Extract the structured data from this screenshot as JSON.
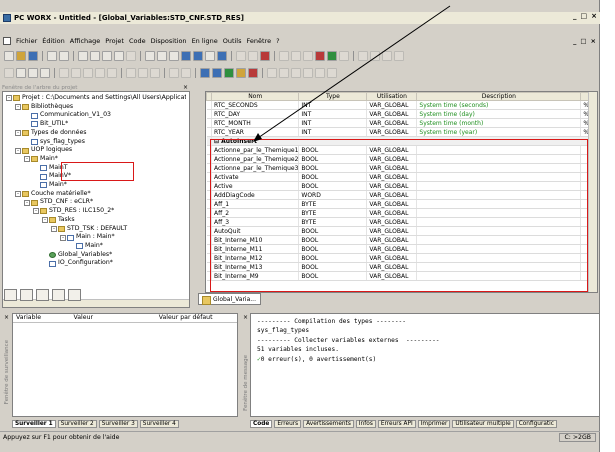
{
  "window": {
    "title": "PC WORX - Untitled - [Global_Variables:STD_CNF.STD_RES]",
    "minimize": "_",
    "restore": "□",
    "close": "×"
  },
  "menu": {
    "items": [
      "Fichier",
      "Édition",
      "Affichage",
      "Projet",
      "Code",
      "Disposition",
      "En ligne",
      "Outils",
      "Fenêtre",
      "?"
    ],
    "mdi_min": "_",
    "mdi_restore": "□",
    "mdi_close": "×"
  },
  "project_tree": {
    "caption": "Fenêtre de l'arbre du projet",
    "items": [
      {
        "text": "Projet : C:\\Documents and Settings\\All Users\\Applicat",
        "indent": 0,
        "icon": "folder",
        "pm": "-"
      },
      {
        "text": "Bibliothèques",
        "indent": 1,
        "icon": "folder",
        "pm": "-"
      },
      {
        "text": "Communication_V1_03",
        "indent": 2,
        "icon": "file",
        "pm": ""
      },
      {
        "text": "Bit_UTIL*",
        "indent": 2,
        "icon": "file",
        "pm": ""
      },
      {
        "text": "Types de données",
        "indent": 1,
        "icon": "folder",
        "pm": "-"
      },
      {
        "text": "sys_flag_types",
        "indent": 2,
        "icon": "file",
        "pm": ""
      },
      {
        "text": "UOP logiques",
        "indent": 1,
        "icon": "folder",
        "pm": "-"
      },
      {
        "text": "Main*",
        "indent": 2,
        "icon": "folder",
        "pm": "-"
      },
      {
        "text": "MainT",
        "indent": 3,
        "icon": "file",
        "pm": ""
      },
      {
        "text": "MainV*",
        "indent": 3,
        "icon": "file",
        "pm": ""
      },
      {
        "text": "Main*",
        "indent": 3,
        "icon": "file",
        "pm": ""
      },
      {
        "text": "Couche matérielle*",
        "indent": 1,
        "icon": "folder",
        "pm": "-"
      },
      {
        "text": "STD_CNF : eCLR*",
        "indent": 2,
        "icon": "folder",
        "pm": "-"
      },
      {
        "text": "STD_RES : ILC150_2*",
        "indent": 3,
        "icon": "folder",
        "pm": "-"
      },
      {
        "text": "Tasks",
        "indent": 4,
        "icon": "folder",
        "pm": "-"
      },
      {
        "text": "STD_TSK : DEFAULT",
        "indent": 5,
        "icon": "folder",
        "pm": "-"
      },
      {
        "text": "Main : Main*",
        "indent": 6,
        "icon": "file",
        "pm": "-"
      },
      {
        "text": "Main*",
        "indent": 7,
        "icon": "file",
        "pm": ""
      },
      {
        "text": "Global_Variables*",
        "indent": 4,
        "icon": "var",
        "pm": ""
      },
      {
        "text": "IO_Configuration*",
        "indent": 4,
        "icon": "file",
        "pm": ""
      }
    ]
  },
  "grid": {
    "headers": [
      "",
      "Nom",
      "Type",
      "Utilisation",
      "Description",
      ""
    ],
    "rows": [
      {
        "name": "RTC_SECONDS",
        "type": "INT",
        "usage": "VAR_GLOBAL",
        "desc": "System time (seconds)",
        "extra": "%"
      },
      {
        "name": "RTC_DAY",
        "type": "INT",
        "usage": "VAR_GLOBAL",
        "desc": "System time (day)",
        "extra": "%"
      },
      {
        "name": "RTC_MONTH",
        "type": "INT",
        "usage": "VAR_GLOBAL",
        "desc": "System time (month)",
        "extra": "%"
      },
      {
        "name": "RTC_YEAR",
        "type": "INT",
        "usage": "VAR_GLOBAL",
        "desc": "System time (year)",
        "extra": "%"
      },
      {
        "group": "⊟ AutoInsert"
      },
      {
        "name": "Actionne_par_le_Themique1",
        "type": "BOOL",
        "usage": "VAR_GLOBAL",
        "desc": "",
        "extra": ""
      },
      {
        "name": "Actionne_par_le_Themique2",
        "type": "BOOL",
        "usage": "VAR_GLOBAL",
        "desc": "",
        "extra": ""
      },
      {
        "name": "Actionne_par_le_Themique3",
        "type": "BOOL",
        "usage": "VAR_GLOBAL",
        "desc": "",
        "extra": ""
      },
      {
        "name": "Activate",
        "type": "BOOL",
        "usage": "VAR_GLOBAL",
        "desc": "",
        "extra": ""
      },
      {
        "name": "Active",
        "type": "BOOL",
        "usage": "VAR_GLOBAL",
        "desc": "",
        "extra": ""
      },
      {
        "name": "AddDiagCode",
        "type": "WORD",
        "usage": "VAR_GLOBAL",
        "desc": "",
        "extra": ""
      },
      {
        "name": "Aff_1",
        "type": "BYTE",
        "usage": "VAR_GLOBAL",
        "desc": "",
        "extra": ""
      },
      {
        "name": "Aff_2",
        "type": "BYTE",
        "usage": "VAR_GLOBAL",
        "desc": "",
        "extra": ""
      },
      {
        "name": "Aff_3",
        "type": "BYTE",
        "usage": "VAR_GLOBAL",
        "desc": "",
        "extra": ""
      },
      {
        "name": "AutoQuit",
        "type": "BOOL",
        "usage": "VAR_GLOBAL",
        "desc": "",
        "extra": ""
      },
      {
        "name": "Bit_Interne_M10",
        "type": "BOOL",
        "usage": "VAR_GLOBAL",
        "desc": "",
        "extra": ""
      },
      {
        "name": "Bit_Interne_M11",
        "type": "BOOL",
        "usage": "VAR_GLOBAL",
        "desc": "",
        "extra": ""
      },
      {
        "name": "Bit_Interne_M12",
        "type": "BOOL",
        "usage": "VAR_GLOBAL",
        "desc": "",
        "extra": ""
      },
      {
        "name": "Bit_Interne_M13",
        "type": "BOOL",
        "usage": "VAR_GLOBAL",
        "desc": "",
        "extra": ""
      },
      {
        "name": "Bit_Interne_M9",
        "type": "BOOL",
        "usage": "VAR_GLOBAL",
        "desc": "",
        "extra": ""
      }
    ],
    "tab_label": "Global_Varia..."
  },
  "watch": {
    "caption": "Fenêtre de surveillance",
    "headers": [
      "Variable",
      "Valeur",
      "Valeur par défaut"
    ],
    "tabs": [
      "Surveiller 1",
      "Surveiller 2",
      "Surveiller 3",
      "Surveiller 4"
    ]
  },
  "messages": {
    "caption": "Fenêtre de message",
    "lines": [
      "--------- Compilation des types --------",
      "sys_flag_types",
      "--------- Collecter variables externes  ---------",
      "51 variables incluses.",
      "0 erreur(s), 0 avertissement(s)"
    ],
    "tabs": [
      "Code",
      "Erreurs",
      "Avertissements",
      "Infos",
      "Erreurs API",
      "Imprimer",
      "Utilisateur multiple",
      "Configuratic"
    ]
  },
  "status": {
    "help": "Appuyez sur F1 pour obtenir de l'aide",
    "right": "C: >2GB"
  },
  "colors": {
    "highlight_red": "#d91818",
    "description_green": "#1f8f1f"
  }
}
